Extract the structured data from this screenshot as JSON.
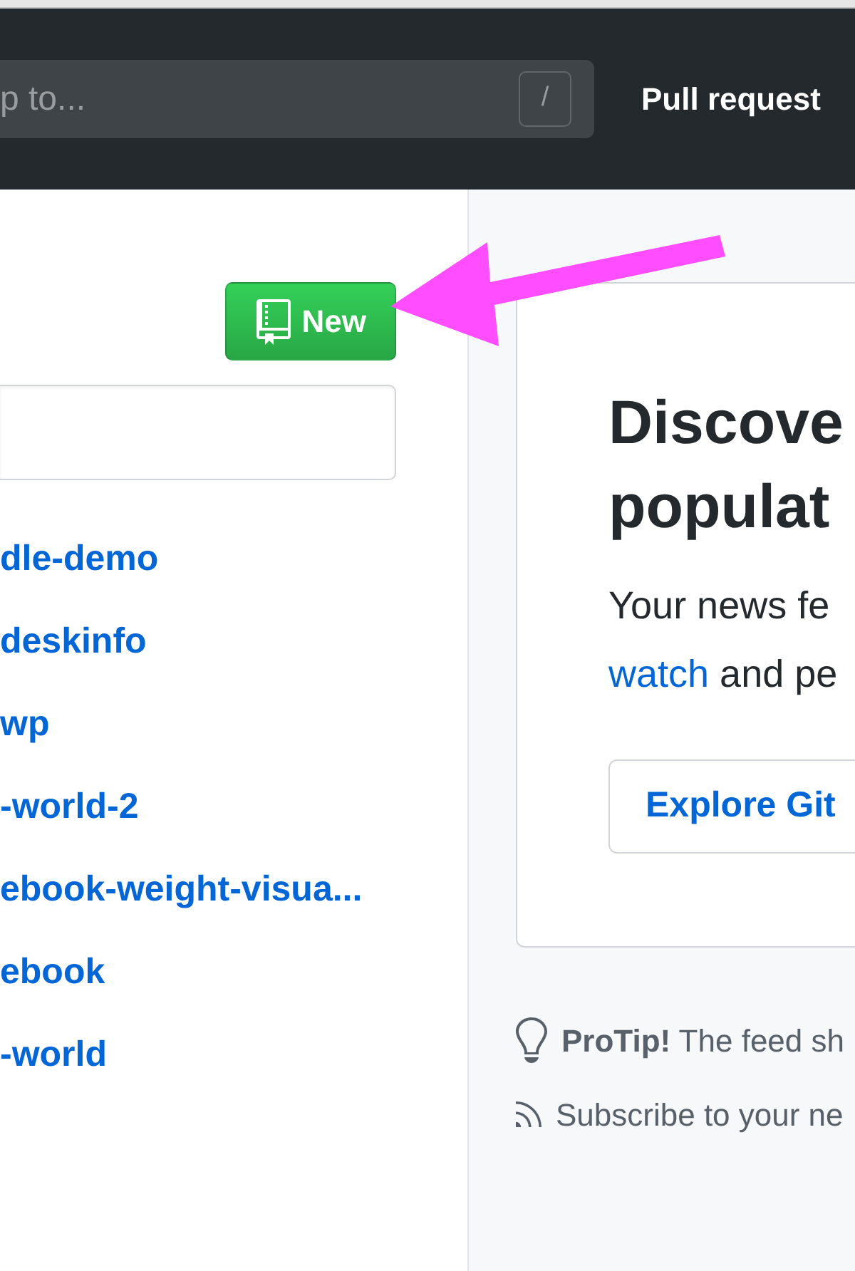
{
  "header": {
    "search": {
      "placeholder": "p to..."
    },
    "shortcut_key": "/",
    "nav_links": [
      {
        "label": "Pull request"
      }
    ]
  },
  "sidebar": {
    "new_button": {
      "label": "New"
    },
    "repositories": [
      {
        "name": "dle-demo"
      },
      {
        "name": "deskinfo"
      },
      {
        "name": "wp"
      },
      {
        "name": "-world-2"
      },
      {
        "name": "ebook-weight-visua..."
      },
      {
        "name": "ebook"
      },
      {
        "name": "-world"
      }
    ]
  },
  "feed": {
    "card": {
      "title_lines": [
        "Discove",
        "populat"
      ],
      "description_lines": [
        [
          {
            "kind": "text",
            "text": "Your news fe"
          }
        ],
        [
          {
            "kind": "link",
            "text": "watch"
          },
          {
            "kind": "text",
            "text": " and pe"
          }
        ]
      ],
      "button": {
        "label": "Explore Git"
      }
    },
    "protip": "**ProTip!** The feed sh",
    "subscribe_link": {
      "label": "Subscribe to your ne"
    }
  }
}
